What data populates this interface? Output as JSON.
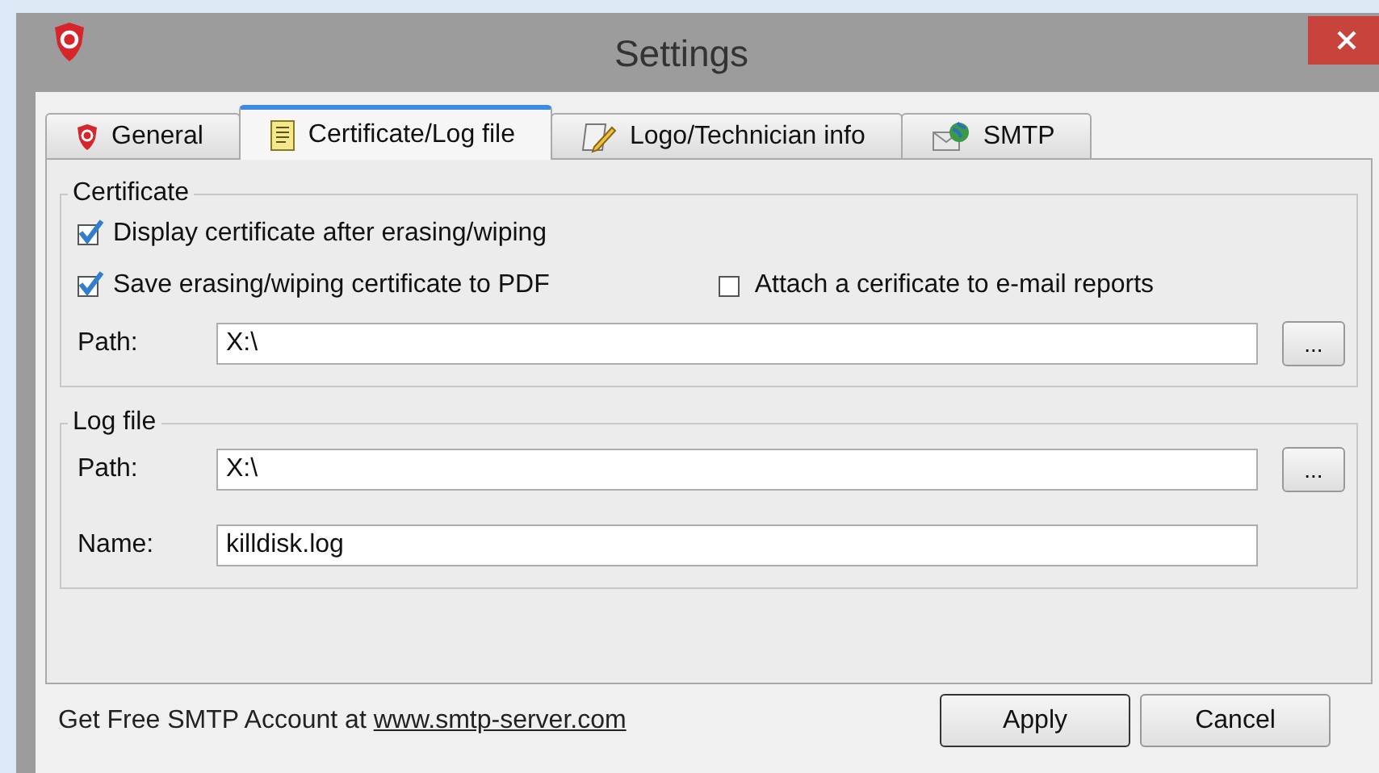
{
  "window": {
    "title": "Settings"
  },
  "tabs": [
    {
      "label": "General",
      "selected": false,
      "kind": "shield"
    },
    {
      "label": "Certificate/Log file",
      "selected": true,
      "kind": "notepad"
    },
    {
      "label": "Logo/Technician info",
      "selected": false,
      "kind": "scroll"
    },
    {
      "label": "SMTP",
      "selected": false,
      "kind": "globe"
    }
  ],
  "certificate": {
    "legend": "Certificate",
    "checkbox_rows": [
      [
        {
          "label": "Display certificate after erasing/wiping",
          "checked": true
        }
      ],
      [
        {
          "label": "Save erasing/wiping certificate to PDF",
          "checked": true
        },
        {
          "label": "Attach a cerificate to e-mail reports",
          "checked": false
        }
      ]
    ],
    "path": {
      "label": "Path:",
      "value": "X:\\",
      "browse": "..."
    }
  },
  "log_file": {
    "legend": "Log file",
    "path": {
      "label": "Path:",
      "value": "X:\\",
      "browse": "..."
    },
    "name": {
      "label": "Name:",
      "value": "killdisk.log"
    }
  },
  "footer": {
    "text": "Get Free SMTP Account at",
    "link": "www.smtp-server.com"
  },
  "buttons": [
    {
      "label": "Apply",
      "kind": "default"
    },
    {
      "label": "Cancel",
      "kind": "normal"
    }
  ]
}
